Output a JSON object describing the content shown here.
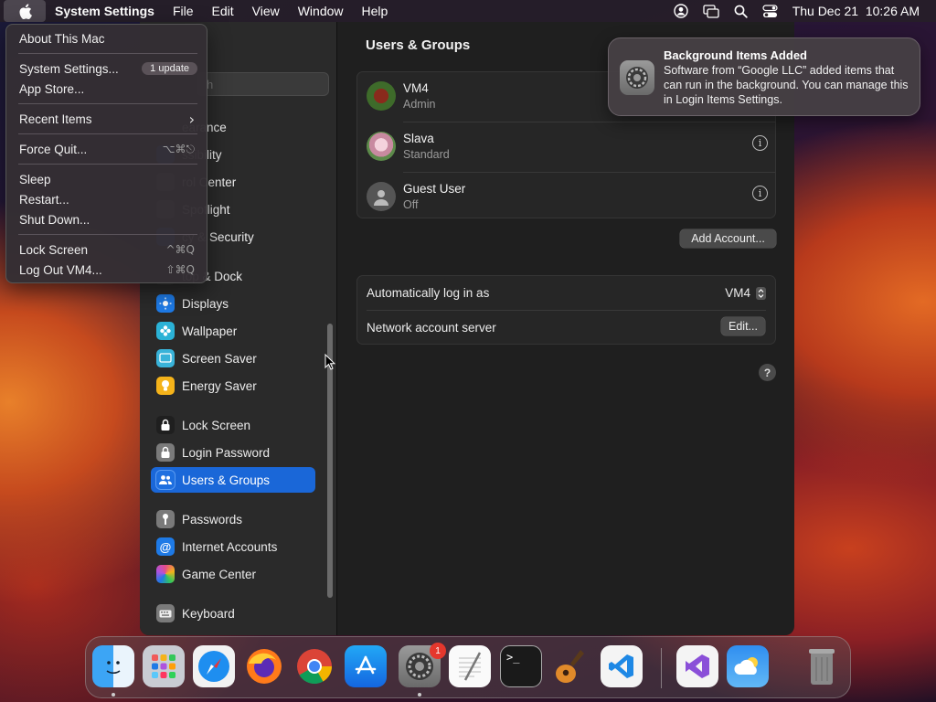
{
  "menubar": {
    "app_name": "System Settings",
    "menus": [
      "File",
      "Edit",
      "View",
      "Window",
      "Help"
    ],
    "datetime": "Thu Dec 21  10:26 AM"
  },
  "apple_menu": {
    "items": [
      {
        "label": "About This Mac"
      },
      {
        "label": "System Settings...",
        "badge": "1 update"
      },
      {
        "label": "App Store..."
      },
      {
        "label": "Recent Items",
        "arrow": "›"
      },
      {
        "label": "Force Quit...",
        "shortcut": "⌥⌘⎋"
      },
      {
        "label": "Sleep"
      },
      {
        "label": "Restart..."
      },
      {
        "label": "Shut Down..."
      },
      {
        "label": "Lock Screen",
        "shortcut": "^⌘Q"
      },
      {
        "label": "Log Out VM4...",
        "shortcut": "⇧⌘Q"
      }
    ]
  },
  "sidebar": {
    "search_placeholder": "h",
    "items": [
      {
        "label": "earance",
        "color": "#2f2f2f"
      },
      {
        "label": "ssibility",
        "color": "#1e6fe0"
      },
      {
        "label": "rol Center",
        "color": "#6a6a6a"
      },
      {
        "label": "Spotlight",
        "color": "#6a6a6a"
      },
      {
        "label": "cy & Security",
        "color": "#1e6fe0"
      },
      {
        "label": "top & Dock",
        "color": "#2f2f2f"
      },
      {
        "label": "Displays",
        "color": "#1e7ae6"
      },
      {
        "label": "Wallpaper",
        "color": "#2bb2d6"
      },
      {
        "label": "Screen Saver",
        "color": "#39b3d9"
      },
      {
        "label": "Energy Saver",
        "color": "#f5b31a"
      },
      {
        "label": "Lock Screen",
        "color": "#1f1f1f"
      },
      {
        "label": "Login Password",
        "color": "#7a7a7a"
      },
      {
        "label": "Users & Groups",
        "color": "#1e6fe0"
      },
      {
        "label": "Passwords",
        "color": "#7a7a7a"
      },
      {
        "label": "Internet Accounts",
        "color": "#1e7ae6"
      },
      {
        "label": "Game Center",
        "color": "#e44d8a"
      },
      {
        "label": "Keyboard",
        "color": "#7a7a7a"
      }
    ]
  },
  "main": {
    "title": "Users & Groups",
    "users": [
      {
        "name": "VM4",
        "role": "Admin"
      },
      {
        "name": "Slava",
        "role": "Standard"
      },
      {
        "name": "Guest User",
        "role": "Off"
      }
    ],
    "add_account_label": "Add Account...",
    "auto_login_label": "Automatically log in as",
    "auto_login_value": "VM4",
    "network_server_label": "Network account server",
    "edit_label": "Edit...",
    "help_label": "?"
  },
  "notification": {
    "title": "Background Items Added",
    "body": "Software from “Google LLC” added items that can run in the background. You can manage this in Login Items Settings."
  },
  "dock": {
    "badge": "1",
    "apps": [
      {
        "name": "Finder"
      },
      {
        "name": "Launchpad"
      },
      {
        "name": "Safari"
      },
      {
        "name": "Firefox"
      },
      {
        "name": "Chrome"
      },
      {
        "name": "App Store"
      },
      {
        "name": "System Settings"
      },
      {
        "name": "TextEdit"
      },
      {
        "name": "Terminal"
      },
      {
        "name": "GarageBand"
      },
      {
        "name": "VS Code"
      },
      {
        "name": "Visual Studio"
      },
      {
        "name": "Weather"
      },
      {
        "name": "Trash"
      }
    ]
  }
}
